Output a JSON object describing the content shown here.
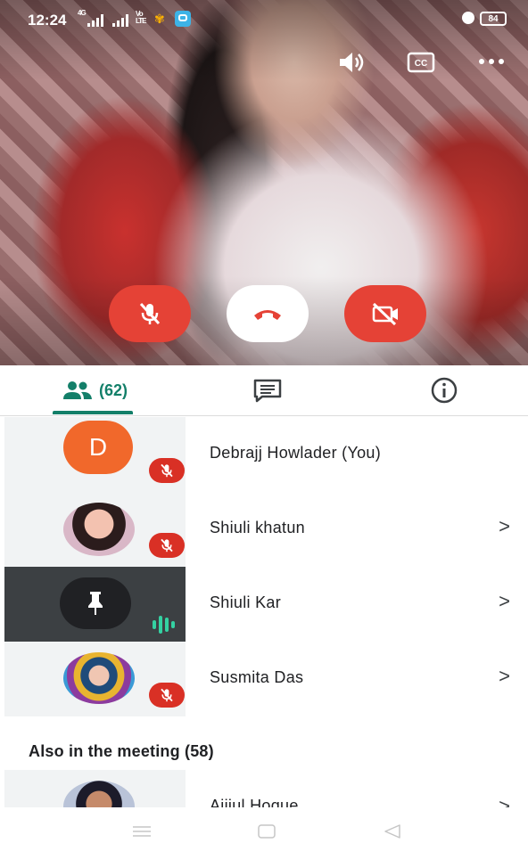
{
  "status_bar": {
    "time": "12:24",
    "signal_text": "4G",
    "volte": "Vo LTE",
    "battery": "84"
  },
  "tabs": {
    "people_count": "(62)"
  },
  "participants": [
    {
      "name": "Debrajj Howlader (You)",
      "initial": "D",
      "muted": true
    },
    {
      "name": "Shiuli khatun",
      "muted": true
    },
    {
      "name": "Shiuli Kar",
      "speaking": true
    },
    {
      "name": "Susmita Das",
      "muted": true
    }
  ],
  "also_in_meeting": {
    "title": "Also in the meeting (58)",
    "first_name": "Ajijul Hoque"
  },
  "colors": {
    "accent": "#137f69",
    "end_call_red": "#e54236",
    "mute_badge": "#d93025",
    "avatar_d": "#f1682b"
  }
}
